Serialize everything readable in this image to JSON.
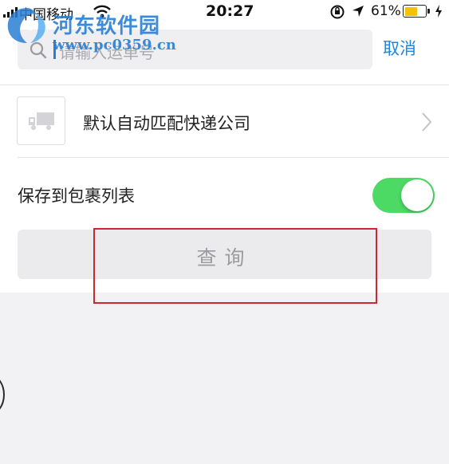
{
  "status_bar": {
    "carrier": "中国移动",
    "time": "20:27",
    "battery_percent": "61%",
    "battery_level": 0.61,
    "battery_color": "#f6c200"
  },
  "watermark": {
    "title": "河东软件园",
    "url": "www.pc0359.cn",
    "color": "#2a7fd4"
  },
  "search": {
    "placeholder": "请输入运单号",
    "cancel_label": "取消",
    "icon": "search-icon"
  },
  "company_row": {
    "label": "默认自动匹配快递公司",
    "icon": "truck-icon",
    "chevron": "chevron-right-icon"
  },
  "save_row": {
    "label": "保存到包裹列表",
    "toggle_on": true,
    "toggle_color": "#4cd964"
  },
  "query_button": {
    "label": "查询"
  },
  "annotation": {
    "highlight_color": "#d0262e"
  },
  "colors": {
    "accent": "#1c86e0",
    "background": "#f2f2f4"
  }
}
